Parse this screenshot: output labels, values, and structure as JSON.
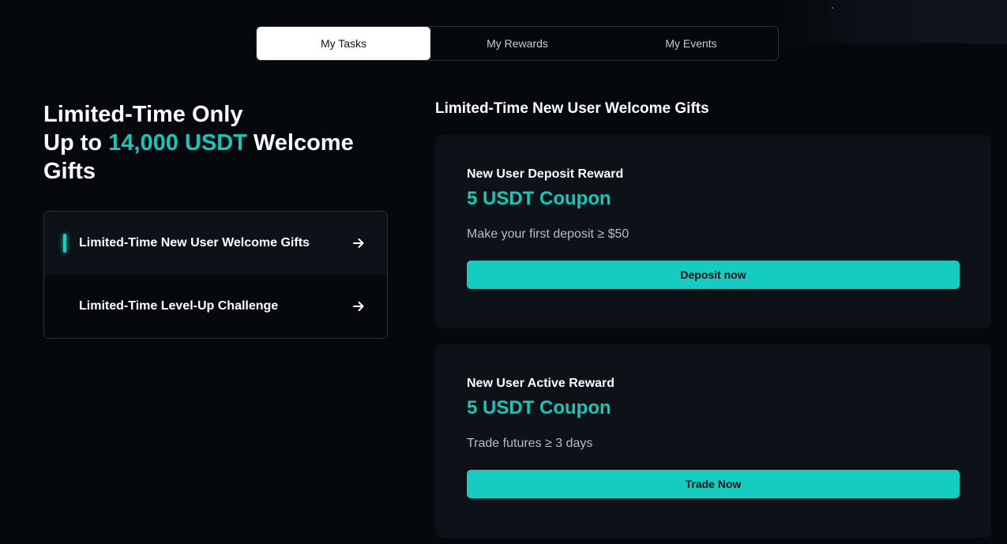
{
  "tabs": [
    {
      "label": "My Tasks",
      "active": true
    },
    {
      "label": "My Rewards",
      "active": false
    },
    {
      "label": "My Events",
      "active": false
    }
  ],
  "headline": {
    "line1": "Limited-Time Only",
    "line2_prefix": "Up to ",
    "line2_accent": "14,000 USDT",
    "line2_suffix": " Welcome",
    "line3": "Gifts",
    "accent_color": "#14c7b8"
  },
  "menu": {
    "items": [
      {
        "label": "Limited-Time New User Welcome Gifts",
        "active": true,
        "icon": "arrow-right-icon"
      },
      {
        "label": "Limited-Time Level-Up Challenge",
        "active": false,
        "icon": "arrow-right-icon"
      }
    ]
  },
  "section": {
    "title": "Limited-Time New User Welcome Gifts"
  },
  "cards": [
    {
      "title": "New User Deposit Reward",
      "value": "5 USDT Coupon",
      "description": "Make your first deposit ≥ $50",
      "button": "Deposit now"
    },
    {
      "title": "New User Active Reward",
      "value": "5 USDT Coupon",
      "description": "Trade futures ≥ 3 days",
      "button": "Trade Now"
    }
  ],
  "colors": {
    "background": "#05080c",
    "card": "#0c1218",
    "accent": "#14cdc0"
  }
}
